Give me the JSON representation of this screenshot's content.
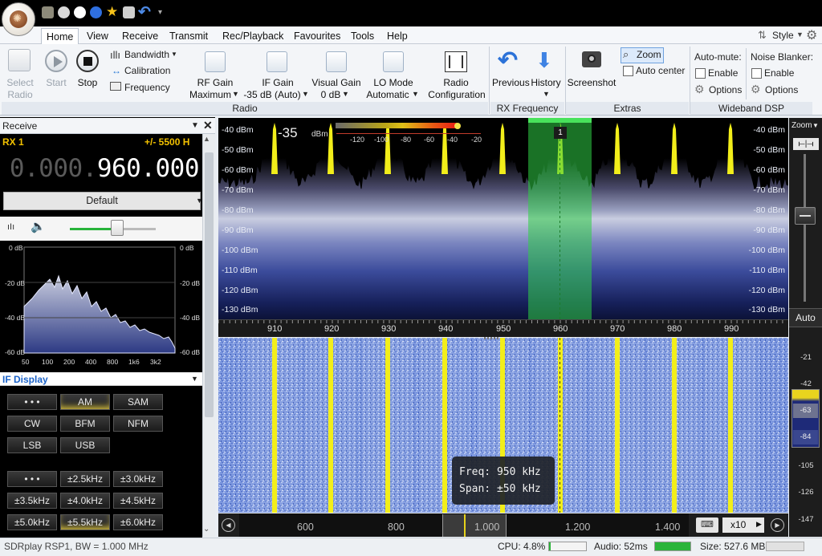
{
  "ribbon_tabs": [
    "Home",
    "View",
    "Receive",
    "Transmit",
    "Rec/Playback",
    "Favourites",
    "Tools",
    "Help"
  ],
  "style_menu": "Style",
  "ribbon": {
    "select_radio": "Select\nRadio",
    "start": "Start",
    "stop": "Stop",
    "bandwidth": "Bandwidth",
    "calibration": "Calibration",
    "frequency": "Frequency",
    "rf_gain_label": "RF Gain",
    "rf_gain_value": "Maximum",
    "if_gain_label": "IF Gain",
    "if_gain_value": "-35 dB (Auto)",
    "visual_gain_label": "Visual Gain",
    "visual_gain_value": "0 dB",
    "lo_mode_label": "LO Mode",
    "lo_mode_value": "Automatic",
    "radio_config_line1": "Radio",
    "radio_config_line2": "Configuration",
    "group_radio": "Radio",
    "previous": "Previous",
    "history": "History",
    "group_rx_frequency": "RX Frequency",
    "screenshot": "Screenshot",
    "zoom": "Zoom",
    "auto_center": "Auto center",
    "group_extras": "Extras",
    "auto_mute": "Auto-mute:",
    "noise_blanker": "Noise Blanker:",
    "enable": "Enable",
    "options": "Options",
    "group_wideband_dsp": "Wideband DSP"
  },
  "receive_panel": {
    "title": "Receive",
    "rx_label": "RX 1",
    "bw_label": "+/- 5500 H",
    "freq_dim": "0.000.",
    "freq_main": "960.000",
    "mode_preset": "Default",
    "vol_level": 0.55,
    "mini_spectrum_y": [
      "0 dB",
      "-20 dB",
      "-40 dB",
      "-60 dB"
    ],
    "mini_spectrum_x": [
      "50",
      "100",
      "200",
      "400",
      "800",
      "1k6",
      "3k2"
    ]
  },
  "if_display": {
    "title": "IF Display",
    "modes": [
      "• • •",
      "AM",
      "SAM",
      "CW",
      "BFM",
      "NFM",
      "LSB",
      "USB"
    ],
    "selected_mode": "AM",
    "bandwidths": [
      "• • •",
      "±2.5kHz",
      "±3.0kHz",
      "±3.5kHz",
      "±4.0kHz",
      "±4.5kHz",
      "±5.0kHz",
      "±5.5kHz",
      "±6.0kHz"
    ],
    "selected_bandwidth": "±5.5kHz"
  },
  "spectrum": {
    "if_gain_readout": "-35",
    "readout_unit": "dBm",
    "meter_scale": [
      "-120",
      "-100",
      "-80",
      "-60",
      "-40",
      "-20"
    ],
    "dbm_left": [
      "-40 dBm",
      "-50 dBm",
      "-60 dBm",
      "-70 dBm",
      "-80 dBm",
      "-90 dBm",
      "-100 dBm",
      "-110 dBm",
      "-120 dBm",
      "-130 dBm"
    ],
    "dbm_right": [
      "-40 dBm",
      "-50 dBm",
      "-60 dBm",
      "-70 dBm",
      "-80 dBm",
      "-90 dBm",
      "-100 dBm",
      "-110 dBm",
      "-120 dBm",
      "-130 dBm"
    ],
    "channel_marker": "1",
    "freq_ticks": [
      "910",
      "920",
      "930",
      "940",
      "950",
      "960",
      "970",
      "980",
      "990"
    ],
    "tooltip_freq": "Freq: 950 kHz",
    "tooltip_span": "Span: ±50 kHz"
  },
  "overview": {
    "ticks": [
      "600",
      "800",
      "1.000",
      "1.200",
      "1.400"
    ],
    "zoom_factor": "x10"
  },
  "right_scale": {
    "zoom": "Zoom",
    "auto": "Auto",
    "ticks": [
      "-21",
      "-42",
      "-63",
      "-84",
      "-105",
      "-126",
      "-147"
    ]
  },
  "status": {
    "device": "SDRplay RSP1, BW = 1.000 MHz",
    "cpu": "CPU: 4.8%",
    "cpu_level": 0.048,
    "audio": "Audio: 52ms",
    "size": "Size: 527.6 MB"
  },
  "colors": {
    "spectrum_peak": "#f2ee1a",
    "selection": "#3fd94f",
    "waterfall_blue": "#6f8fe0"
  }
}
